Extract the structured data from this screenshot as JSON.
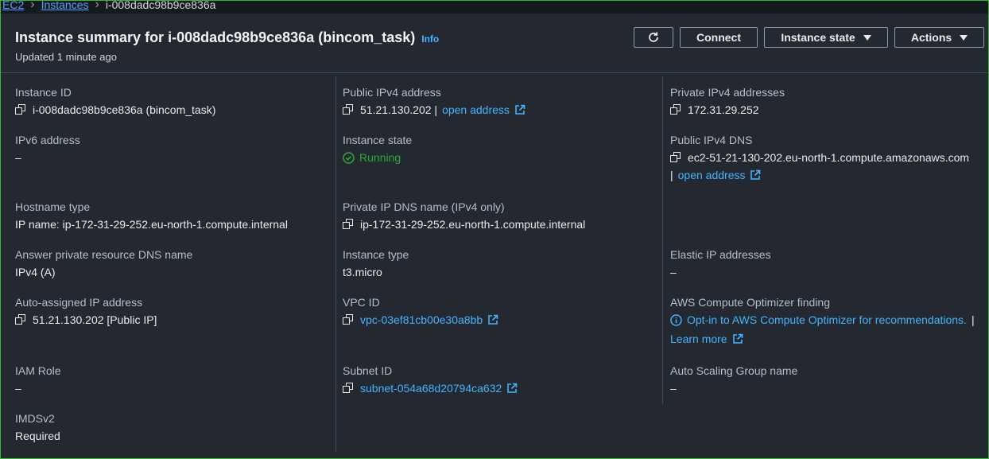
{
  "breadcrumb": {
    "root": "EC2",
    "instances": "Instances",
    "current": "i-008dadc98b9ce836a"
  },
  "header": {
    "title": "Instance summary for i-008dadc98b9ce836a (bincom_task)",
    "info": "Info",
    "updated": "Updated 1 minute ago"
  },
  "buttons": {
    "refresh_icon": "refresh-icon",
    "connect": "Connect",
    "instance_state": "Instance state",
    "actions": "Actions"
  },
  "col1": {
    "instance_id_label": "Instance ID",
    "instance_id_value": "i-008dadc98b9ce836a (bincom_task)",
    "ipv6_label": "IPv6 address",
    "ipv6_value": "–",
    "hostname_label": "Hostname type",
    "hostname_value": "IP name: ip-172-31-29-252.eu-north-1.compute.internal",
    "answer_dns_label": "Answer private resource DNS name",
    "answer_dns_value": "IPv4 (A)",
    "auto_ip_label": "Auto-assigned IP address",
    "auto_ip_value": "51.21.130.202 [Public IP]",
    "iam_label": "IAM Role",
    "iam_value": "–",
    "imds_label": "IMDSv2",
    "imds_value": "Required"
  },
  "col2": {
    "public_ipv4_label": "Public IPv4 address",
    "public_ipv4_value": "51.21.130.202 |",
    "open_address": "open address",
    "state_label": "Instance state",
    "state_value": "Running",
    "private_dns_label": "Private IP DNS name (IPv4 only)",
    "private_dns_value": "ip-172-31-29-252.eu-north-1.compute.internal",
    "type_label": "Instance type",
    "type_value": "t3.micro",
    "vpc_label": "VPC ID",
    "vpc_value": "vpc-03ef81cb00e30a8bb",
    "subnet_label": "Subnet ID",
    "subnet_value": "subnet-054a68d20794ca632"
  },
  "col3": {
    "private_ipv4_label": "Private IPv4 addresses",
    "private_ipv4_value": "172.31.29.252",
    "public_dns_label": "Public IPv4 DNS",
    "public_dns_value": "ec2-51-21-130-202.eu-north-1.compute.amazonaws.com",
    "public_dns_sep": "|",
    "open_address": "open address",
    "elastic_label": "Elastic IP addresses",
    "elastic_value": "–",
    "optimizer_label": "AWS Compute Optimizer finding",
    "optimizer_value": "Opt-in to AWS Compute Optimizer for recommendations.",
    "optimizer_sep": "|",
    "learn_more": "Learn more",
    "asg_label": "Auto Scaling Group name",
    "asg_value": "–"
  },
  "colors": {
    "accent_link": "#42b4ff",
    "running_green": "#29ad32",
    "frame_border": "#2bbf2b"
  }
}
